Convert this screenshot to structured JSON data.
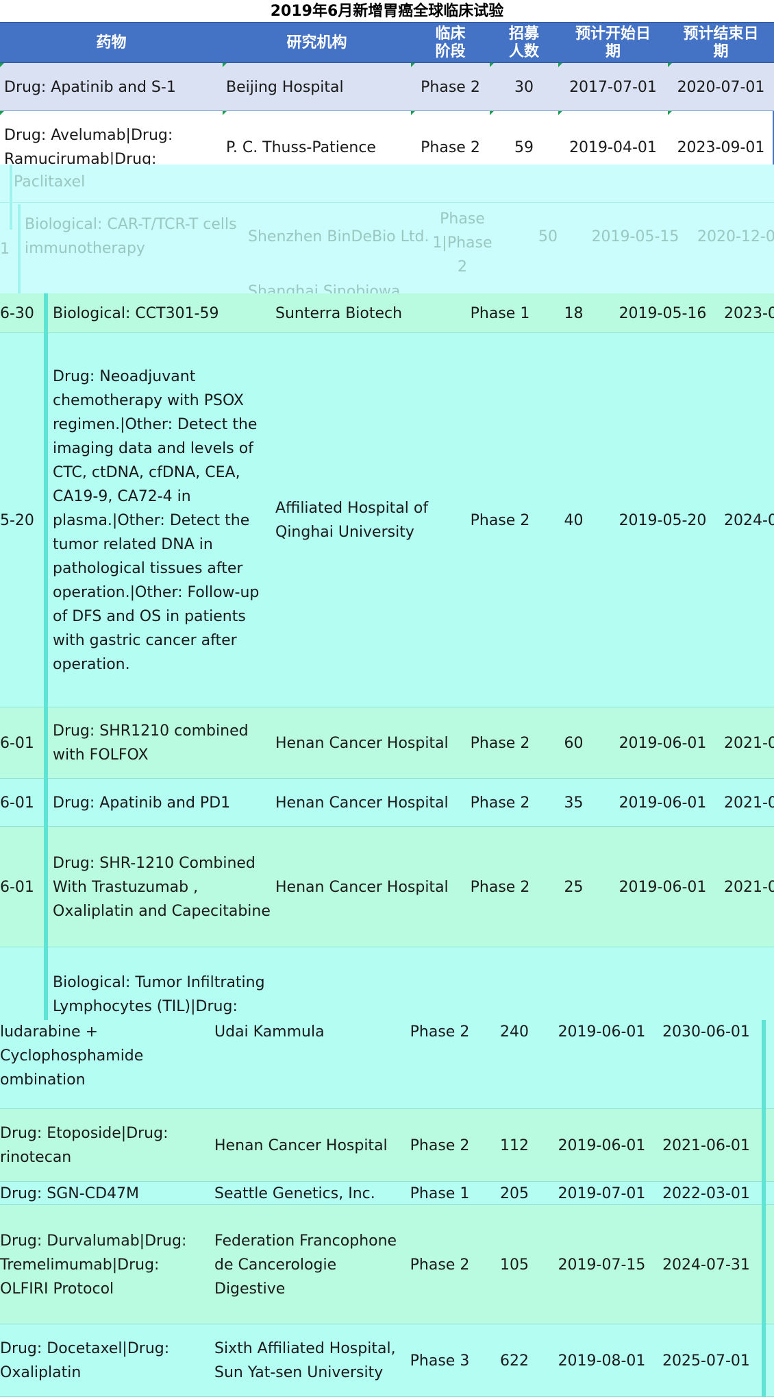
{
  "title": "2019年6月新增胃癌全球临床试验",
  "header": {
    "drug": "药物",
    "institution": "研究机构",
    "phase": "临床\n阶段",
    "enroll": "招募\n人数",
    "start": "预计开始日\n期",
    "end": "预计结束日\n期"
  },
  "rows_top": [
    {
      "drug": "Drug: Apatinib and S-1",
      "institution": "Beijing Hospital",
      "phase": "Phase 2",
      "enroll": "30",
      "start": "2017-07-01",
      "end": "2020-07-01"
    },
    {
      "drug": "Drug: Avelumab|Drug:\nRamucirumab|Drug:",
      "institution": "P. C. Thuss-Patience",
      "phase": "Phase 2",
      "enroll": "59",
      "start": "2019-04-01",
      "end": "2023-09-01"
    }
  ],
  "overlay_faded": {
    "paclitaxel": "Paclitaxel",
    "left_fragment": "1",
    "drug": "Biological: CAR-T/TCR-T cells\nimmunotherapy",
    "institution": "Shenzhen BinDeBio Ltd.",
    "phase": "Phase\n1|Phase\n2",
    "enroll": "50",
    "start": "2019-05-15",
    "end": "2020-12-0",
    "next_institution": "Shanghai Sinobiowa..."
  },
  "rows_mid": [
    {
      "left": "6-30",
      "drug": "Biological: CCT301-59",
      "institution": "Sunterra Biotech",
      "phase": "Phase 1",
      "enroll": "18",
      "start": "2019-05-16",
      "end": "2023-0"
    },
    {
      "left": "5-20",
      "drug": "Drug: Neoadjuvant\nchemotherapy with PSOX\nregimen.|Other: Detect the\nimaging data and levels of\nCTC, ctDNA, cfDNA, CEA,\nCA19-9, CA72-4 in\nplasma.|Other: Detect the\ntumor related DNA in\npathological tissues after\noperation.|Other: Follow-up\nof DFS and OS in patients\nwith gastric cancer after\noperation.",
      "institution": "Affiliated Hospital of\nQinghai University",
      "phase": "Phase 2",
      "enroll": "40",
      "start": "2019-05-20",
      "end": "2024-0"
    },
    {
      "left": "6-01",
      "drug": "Drug: SHR1210 combined\nwith FOLFOX",
      "institution": "Henan Cancer Hospital",
      "phase": "Phase 2",
      "enroll": "60",
      "start": "2019-06-01",
      "end": "2021-0"
    },
    {
      "left": "6-01",
      "drug": "Drug: Apatinib and PD1",
      "institution": "Henan Cancer Hospital",
      "phase": "Phase 2",
      "enroll": "35",
      "start": "2019-06-01",
      "end": "2021-0"
    },
    {
      "left": "6-01",
      "drug": "Drug: SHR-1210 Combined\nWith Trastuzumab ,\nOxaliplatin and Capecitabine",
      "institution": "Henan Cancer Hospital",
      "phase": "Phase 2",
      "enroll": "25",
      "start": "2019-06-01",
      "end": "2021-0"
    },
    {
      "left": "",
      "drug": "Biological: Tumor Infiltrating\nLymphocytes (TIL)|Drug:",
      "institution": "",
      "phase": "",
      "enroll": "",
      "start": "",
      "end": ""
    }
  ],
  "rows_bottom": [
    {
      "drug": "ludarabine +\nCyclophosphamide\nombination",
      "institution": "Udai Kammula",
      "phase": "Phase 2",
      "enroll": "240",
      "start": "2019-06-01",
      "end": "2030-06-01"
    },
    {
      "drug": "Drug: Etoposide|Drug:\nrinotecan",
      "institution": "Henan Cancer Hospital",
      "phase": "Phase 2",
      "enroll": "112",
      "start": "2019-06-01",
      "end": "2021-06-01"
    },
    {
      "drug": "Drug: SGN-CD47M",
      "institution": "Seattle Genetics, Inc.",
      "phase": "Phase 1",
      "enroll": "205",
      "start": "2019-07-01",
      "end": "2022-03-01"
    },
    {
      "drug": "Drug: Durvalumab|Drug:\nTremelimumab|Drug:\nOLFIRI Protocol",
      "institution": "Federation Francophone\nde Cancerologie\nDigestive",
      "phase": "Phase 2",
      "enroll": "105",
      "start": "2019-07-15",
      "end": "2024-07-31"
    },
    {
      "drug": "Drug: Docetaxel|Drug:\nOxaliplatin",
      "institution": "Sixth Affiliated Hospital,\nSun Yat-sen University",
      "phase": "Phase 3",
      "enroll": "622",
      "start": "2019-08-01",
      "end": "2025-07-01"
    }
  ]
}
